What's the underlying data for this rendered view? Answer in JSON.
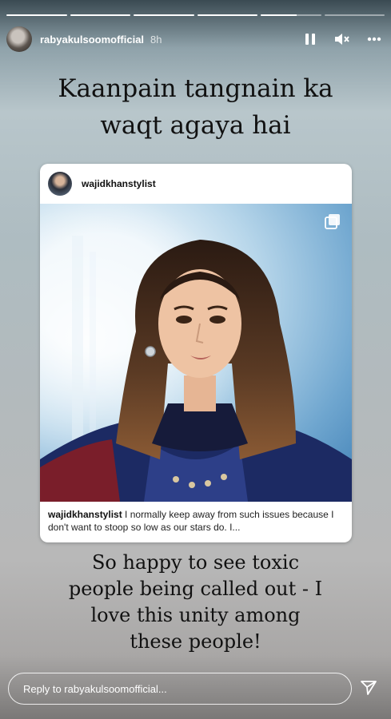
{
  "story": {
    "segments": [
      {
        "progress": 1.0
      },
      {
        "progress": 1.0
      },
      {
        "progress": 1.0
      },
      {
        "progress": 1.0
      },
      {
        "progress": 0.6
      },
      {
        "progress": 0.0
      }
    ]
  },
  "header": {
    "username": "rabyakulsoomofficial",
    "time": "8h",
    "icons": [
      "pause-icon",
      "mute-icon",
      "more-options-icon"
    ]
  },
  "headline": "Kaanpain tangnain ka\nwaqt agaya hai",
  "post": {
    "username": "wajidkhanstylist",
    "caption_user": "wajidkhanstylist",
    "caption_text": "I normally keep away from such issues because I don't want to stoop so low as our stars do. I..."
  },
  "caption": "So happy to see toxic\npeople being called out - I\nlove this unity among\nthese people!",
  "reply": {
    "placeholder": "Reply to rabyakulsoomofficial..."
  },
  "colors": {
    "text": "#111111",
    "overlay": "#ffffff"
  }
}
